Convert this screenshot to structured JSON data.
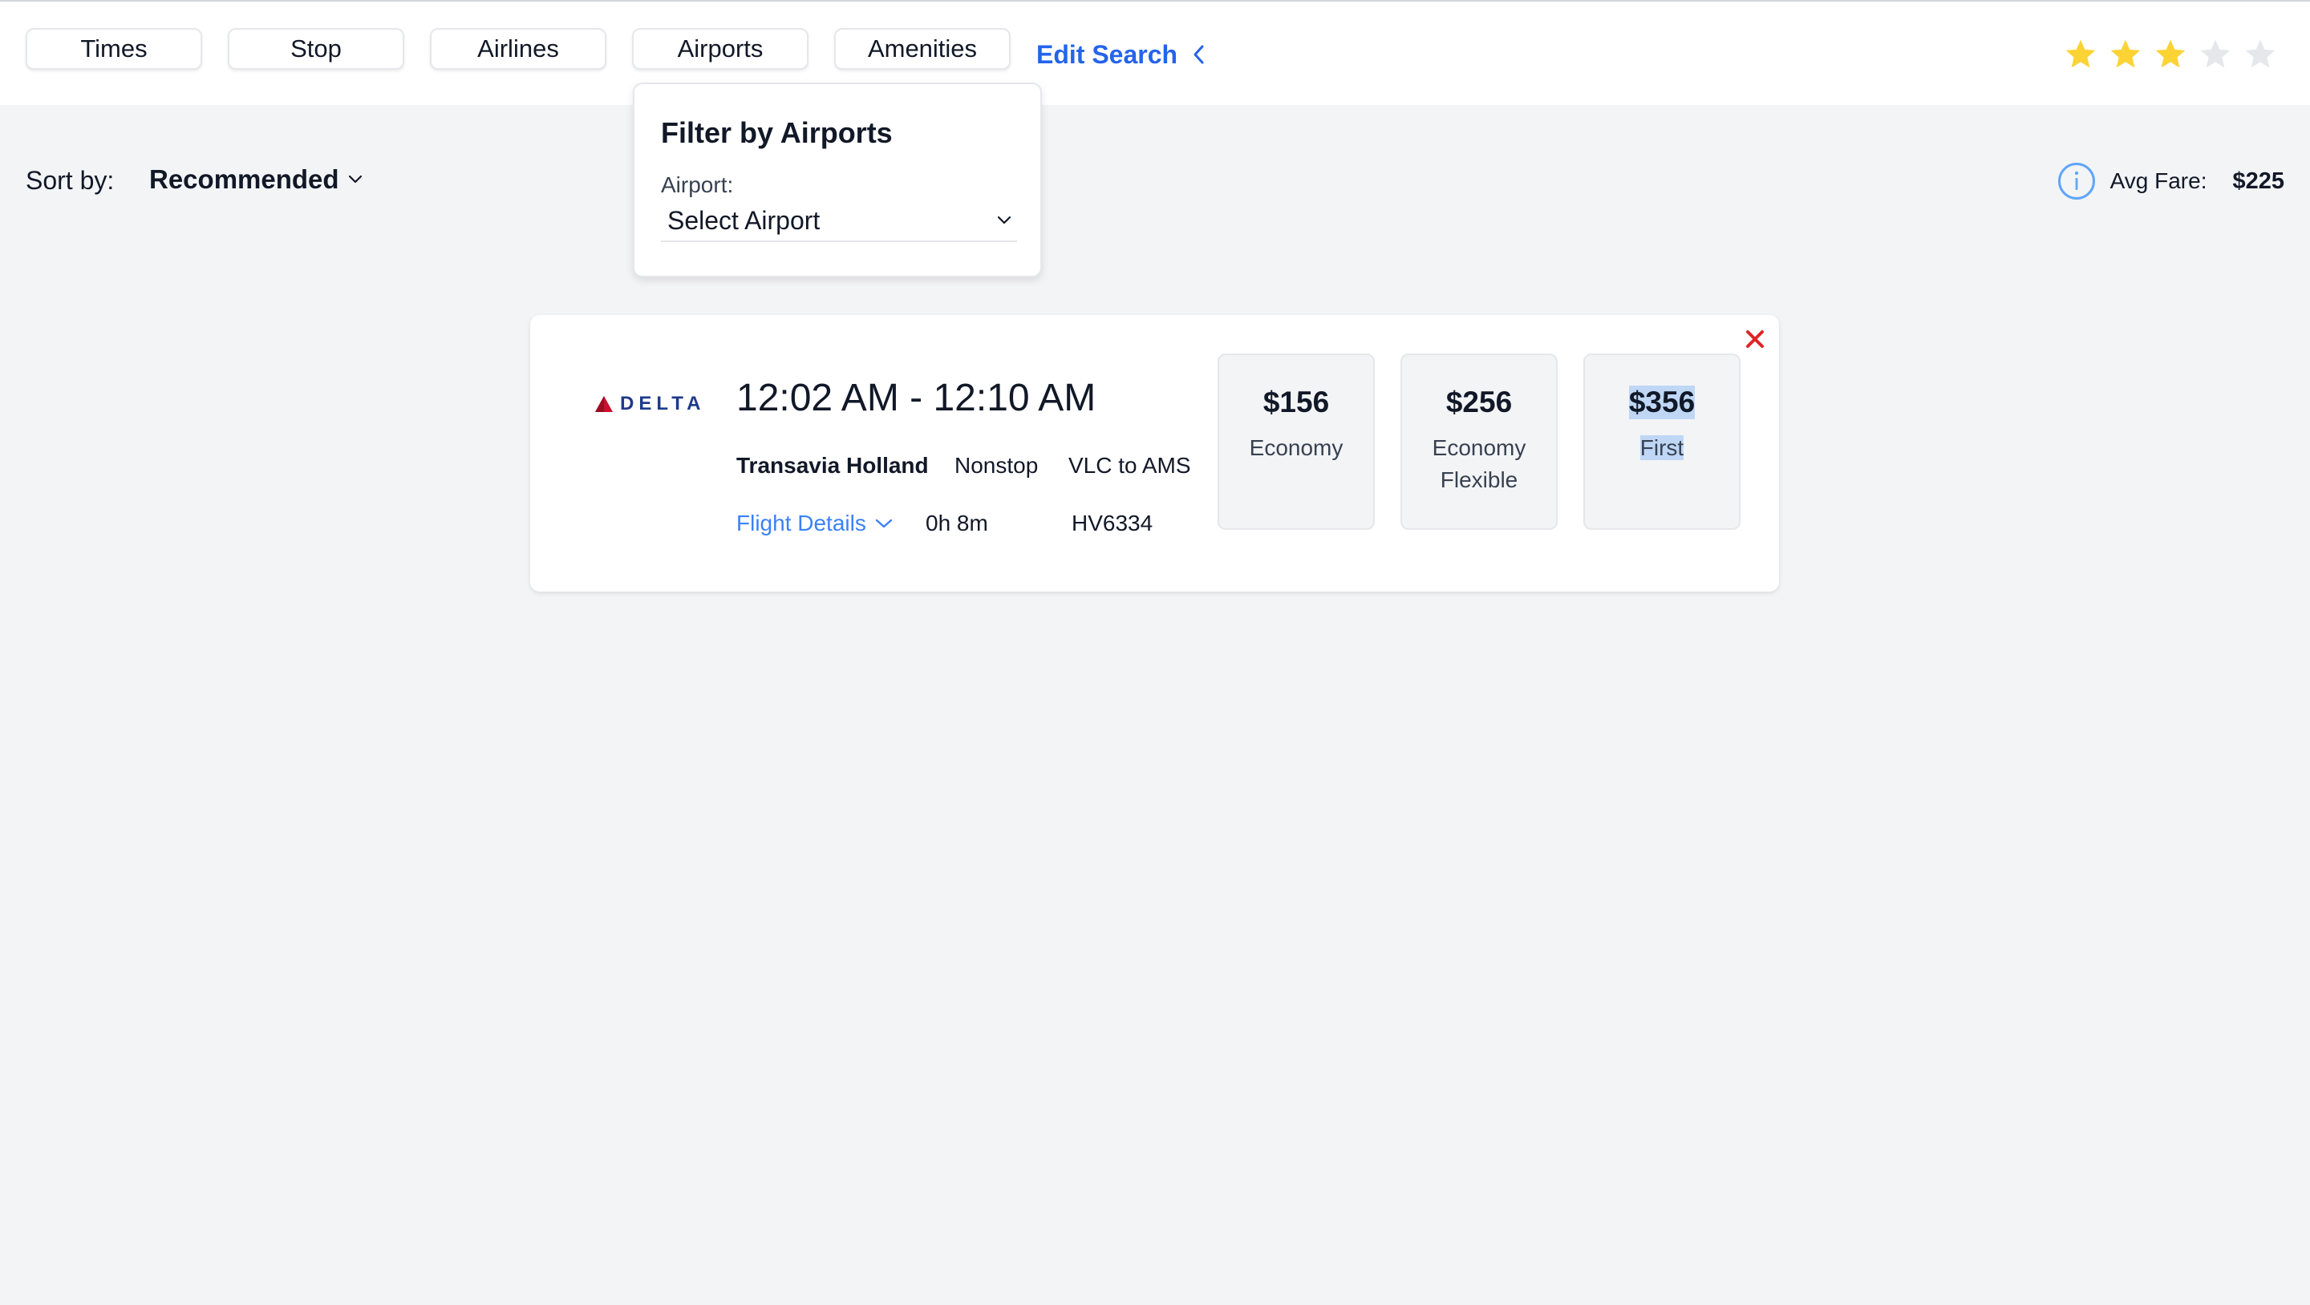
{
  "filters": {
    "tabs": [
      {
        "label": "Times"
      },
      {
        "label": "Stop"
      },
      {
        "label": "Airlines"
      },
      {
        "label": "Airports"
      },
      {
        "label": "Amenities"
      }
    ],
    "edit_search_label": "Edit Search"
  },
  "rating": {
    "value": 3,
    "max": 5,
    "filled_color": "#fbd335",
    "empty_color": "#e5e7eb"
  },
  "sort": {
    "label": "Sort by:",
    "selected": "Recommended"
  },
  "avg_fare": {
    "label": "Avg Fare:",
    "value": "$225",
    "icon": "info-icon"
  },
  "airport_filter": {
    "title": "Filter by Airports",
    "field_label": "Airport:",
    "selected": "Select Airport"
  },
  "flight": {
    "logo_text": "DELTA",
    "times": "12:02 AM - 12:10 AM",
    "airline": "Transavia Holland",
    "stops": "Nonstop",
    "route": "VLC to AMS",
    "details_label": "Flight Details",
    "duration": "0h 8m",
    "flight_number": "HV6334",
    "fares": [
      {
        "price": "$156",
        "class": "Economy"
      },
      {
        "price": "$256",
        "class": "Economy Flexible"
      },
      {
        "price": "$356",
        "class": "First"
      }
    ]
  },
  "colors": {
    "accent": "#2563eb",
    "close": "#dc2626",
    "delta_red": "#c8102e",
    "delta_navy": "#1e3a8a"
  }
}
